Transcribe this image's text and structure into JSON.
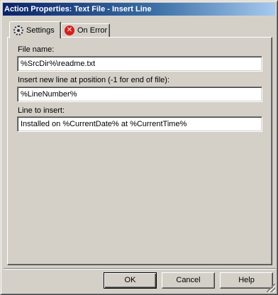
{
  "window": {
    "title": "Action Properties: Text File - Insert Line"
  },
  "tabs": [
    {
      "label": "Settings",
      "icon": "gear-icon",
      "active": true
    },
    {
      "label": "On Error",
      "icon": "error-icon",
      "active": false
    }
  ],
  "fields": {
    "file_name": {
      "label": "File name:",
      "value": "%SrcDir%\\readme.txt"
    },
    "insert_position": {
      "label": "Insert new line at position (-1 for end of file):",
      "value": "%LineNumber%"
    },
    "line_to_insert": {
      "label": "Line to insert:",
      "value": "Installed on %CurrentDate% at %CurrentTime%"
    }
  },
  "buttons": {
    "ok": "OK",
    "cancel": "Cancel",
    "help": "Help"
  },
  "colors": {
    "title_gradient_start": "#0a246a",
    "title_gradient_end": "#a6caf0",
    "dialog_face": "#d4d0c8",
    "error_icon": "#d81e1e"
  }
}
